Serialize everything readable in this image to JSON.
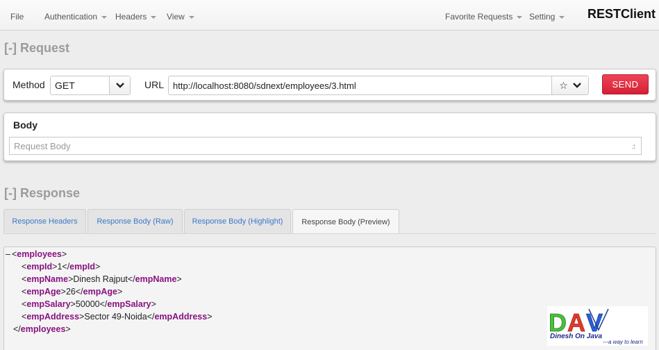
{
  "nav": {
    "file": "File",
    "authentication": "Authentication",
    "headers": "Headers",
    "view": "View",
    "favorite_requests": "Favorite Requests",
    "setting": "Setting",
    "brand": "RESTClient"
  },
  "request": {
    "heading_toggle": "[-]",
    "heading": "Request",
    "method_label": "Method",
    "method_value": "GET",
    "url_label": "URL",
    "url_value": "http://localhost:8080/sdnext/employees/3.html",
    "send_label": "SEND",
    "body_title": "Body",
    "body_placeholder": "Request Body"
  },
  "response": {
    "heading_toggle": "[-]",
    "heading": "Response",
    "tabs": [
      {
        "label": "Response Headers",
        "active": false
      },
      {
        "label": "Response Body (Raw)",
        "active": false
      },
      {
        "label": "Response Body (Highlight)",
        "active": false
      },
      {
        "label": "Response Body (Preview)",
        "active": true
      }
    ],
    "xml": {
      "collapse_symbol": "–",
      "root_tag": "employees",
      "fields": [
        {
          "tag": "empId",
          "value": "1"
        },
        {
          "tag": "empName",
          "value": "Dinesh Rajput"
        },
        {
          "tag": "empAge",
          "value": "26"
        },
        {
          "tag": "empSalary",
          "value": "50000"
        },
        {
          "tag": "empAddress",
          "value": "Sector 49-Noida"
        }
      ]
    }
  },
  "logo": {
    "letters": "DAV",
    "name": "Dinesh On Java",
    "tagline": "---a way to learn"
  },
  "colors": {
    "send": "#e0283e",
    "tab_link": "#3a78c9",
    "xml_tag": "#881280",
    "heading_gray": "#9b9b9b"
  }
}
